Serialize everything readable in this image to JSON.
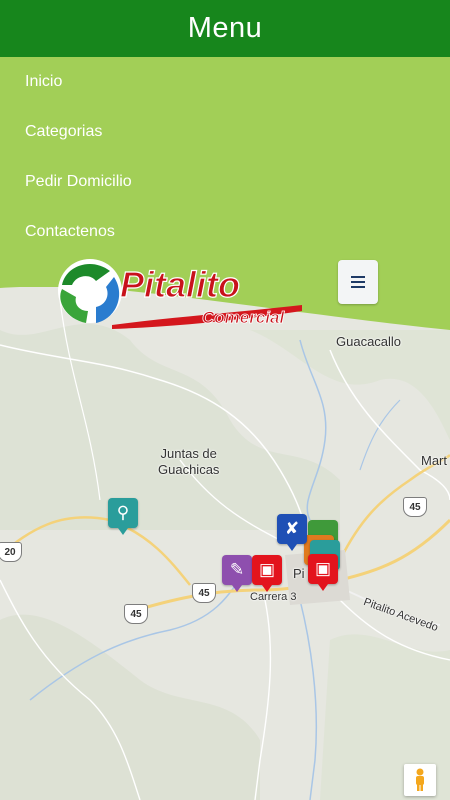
{
  "header": {
    "title": "Menu"
  },
  "menu": {
    "items": [
      {
        "label": "Inicio"
      },
      {
        "label": "Categorias"
      },
      {
        "label": "Pedir Domicilio"
      },
      {
        "label": "Contactenos"
      }
    ]
  },
  "logo": {
    "text_main": "Pitalito",
    "text_sub": "Comercial"
  },
  "map": {
    "places": {
      "guacacallo": "Guacacallo",
      "juntas_line1": "Juntas de",
      "juntas_line2": "Guachicas",
      "mart": "Mart",
      "carrera": "Carrera 3",
      "pi": "Pi",
      "acevedo": "Pitalito Acevedo"
    },
    "routes": {
      "r45a": "45",
      "r45b": "45",
      "r45c": "45",
      "r20": "20"
    }
  },
  "colors": {
    "topbar": "#17861c",
    "menu_bg": "#a2cf57",
    "map_bg": "#e6e7e0",
    "pin_teal": "#2a9d9b",
    "pin_blue": "#1f50b5",
    "pin_red": "#e3141d",
    "pin_purple": "#8e4fae"
  },
  "icons": {
    "hamburger": "hamburger-icon",
    "balloons": "balloons-icon",
    "restaurant": "fork-knife-icon",
    "food": "food-tray-icon",
    "pencil": "pencil-icon",
    "pegman": "pegman-icon"
  }
}
